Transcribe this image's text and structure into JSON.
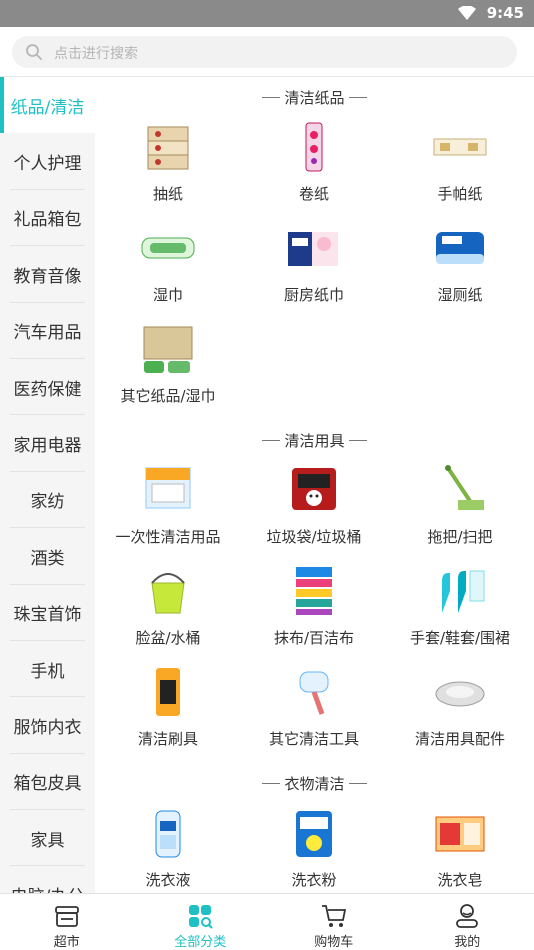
{
  "status": {
    "time": "9:45"
  },
  "search": {
    "placeholder": "点击进行搜索"
  },
  "sidebar": {
    "items": [
      {
        "label": "纸品/清洁",
        "active": true
      },
      {
        "label": "个人护理"
      },
      {
        "label": "礼品箱包"
      },
      {
        "label": "教育音像"
      },
      {
        "label": "汽车用品"
      },
      {
        "label": "医药保健"
      },
      {
        "label": "家用电器"
      },
      {
        "label": "家纺"
      },
      {
        "label": "酒类"
      },
      {
        "label": "珠宝首饰"
      },
      {
        "label": "手机"
      },
      {
        "label": "服饰内衣"
      },
      {
        "label": "箱包皮具"
      },
      {
        "label": "家具"
      },
      {
        "label": "电脑/办公"
      }
    ]
  },
  "sections": [
    {
      "title": "清洁纸品",
      "items": [
        {
          "label": "抽纸",
          "icon": "tissue-box-icon"
        },
        {
          "label": "卷纸",
          "icon": "toilet-roll-icon"
        },
        {
          "label": "手帕纸",
          "icon": "pocket-tissue-icon"
        },
        {
          "label": "湿巾",
          "icon": "wet-wipes-icon"
        },
        {
          "label": "厨房纸巾",
          "icon": "kitchen-towel-icon"
        },
        {
          "label": "湿厕纸",
          "icon": "toilet-wipes-icon"
        },
        {
          "label": "其它纸品/湿巾",
          "icon": "other-paper-icon"
        }
      ]
    },
    {
      "title": "清洁用具",
      "items": [
        {
          "label": "一次性清洁用品",
          "icon": "disposable-cleaning-icon"
        },
        {
          "label": "垃圾袋/垃圾桶",
          "icon": "trash-bag-icon"
        },
        {
          "label": "拖把/扫把",
          "icon": "mop-icon"
        },
        {
          "label": "脸盆/水桶",
          "icon": "bucket-icon"
        },
        {
          "label": "抹布/百洁布",
          "icon": "cloth-icon"
        },
        {
          "label": "手套/鞋套/围裙",
          "icon": "gloves-icon"
        },
        {
          "label": "清洁刷具",
          "icon": "brush-icon"
        },
        {
          "label": "其它清洁工具",
          "icon": "lint-roller-icon"
        },
        {
          "label": "清洁用具配件",
          "icon": "mop-head-icon"
        }
      ]
    },
    {
      "title": "衣物清洁",
      "items": [
        {
          "label": "洗衣液",
          "icon": "laundry-liquid-icon"
        },
        {
          "label": "洗衣粉",
          "icon": "laundry-powder-icon"
        },
        {
          "label": "洗衣皂",
          "icon": "laundry-soap-icon"
        }
      ]
    }
  ],
  "tabbar": {
    "items": [
      {
        "label": "超市",
        "icon": "store-icon"
      },
      {
        "label": "全部分类",
        "icon": "category-icon",
        "active": true
      },
      {
        "label": "购物车",
        "icon": "cart-icon"
      },
      {
        "label": "我的",
        "icon": "profile-icon"
      }
    ]
  },
  "colors": {
    "accent": "#1fc0c4",
    "statusbar": "#8a8a8a",
    "sidebar_bg": "#f5f5f5"
  }
}
